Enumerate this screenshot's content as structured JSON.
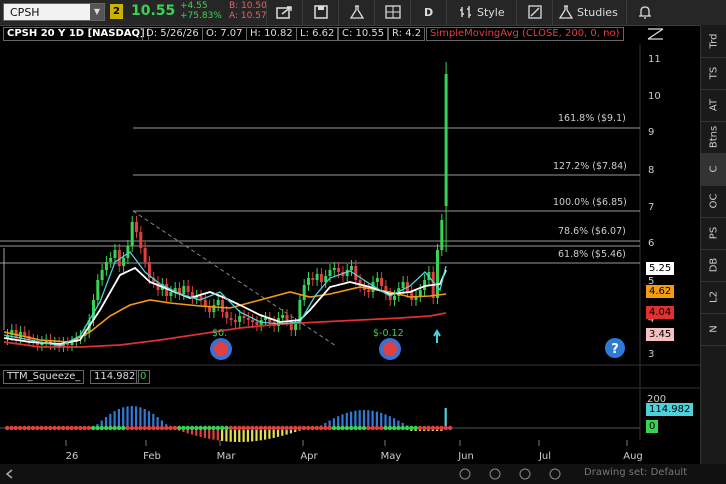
{
  "topbar": {
    "symbol": "CPSH",
    "link_badge": "2",
    "last_price": "10.55",
    "change": "+4.55",
    "change_pct": "+75.83%",
    "bid": "B: 10.50",
    "ask": "A: 10.57",
    "period": "D",
    "style_label": "Style",
    "studies_label": "Studies"
  },
  "header": {
    "title": "CPSH 20 Y 1D [NASDAQ]",
    "date": "D: 5/26/26",
    "open": "O: 7.07",
    "high": "H: 10.82",
    "low": "L: 6.62",
    "close": "C: 10.55",
    "range": "R: 4.2",
    "study": "SimpleMovingAvg (CLOSE, 200, 0, no)"
  },
  "price_axis": [
    "11",
    "10",
    "9",
    "8",
    "7",
    "6",
    "5",
    "4",
    "3"
  ],
  "fib_levels": [
    {
      "label": "161.8%",
      "price": "($9.1)"
    },
    {
      "label": "127.2%",
      "price": "($7.84)"
    },
    {
      "label": "100.0%",
      "price": "($6.85)"
    },
    {
      "label": "78.6%",
      "price": "($6.07)"
    },
    {
      "label": "61.8%",
      "price": "($5.46)"
    }
  ],
  "price_labels": [
    {
      "value": "5.25",
      "bg": "#ffffff"
    },
    {
      "value": "4.62",
      "bg": "#f39c12"
    },
    {
      "value": "4.04",
      "bg": "#e03030"
    },
    {
      "value": "3.45",
      "bg": "#f5c0c0"
    }
  ],
  "chart_annotations": {
    "earnings_1": "$0.",
    "earnings_2": "$-0.12"
  },
  "squeeze": {
    "name": "TTM_Squeeze_",
    "value": "114.982",
    "zero": "0",
    "axis_label": "200",
    "value_tag": "114.982",
    "zero_tag": "0"
  },
  "time_axis": [
    "26",
    "Feb",
    "Mar",
    "Apr",
    "May",
    "Jun",
    "Jul",
    "Aug"
  ],
  "right_tabs": [
    "Trd",
    "TS",
    "AT",
    "Btns",
    "C",
    "OC",
    "PS",
    "DB",
    "L2",
    "N"
  ],
  "right_tab_selected": "C",
  "drawing_set": "Drawing set: Default",
  "colors": {
    "up": "#39d353",
    "down": "#e04040",
    "sma200": "#e03030",
    "ema_orange": "#f39c12",
    "ma_white": "#ffffff",
    "ma_cyan": "#4fd1d9"
  },
  "icons": [
    "chevron-down-icon",
    "share-icon",
    "save-icon",
    "flask-icon",
    "layout-icon",
    "draw-icon",
    "studies-flask-icon",
    "bell-icon",
    "expand-icon",
    "info-icon"
  ]
}
